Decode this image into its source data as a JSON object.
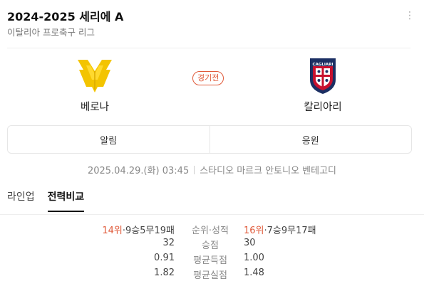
{
  "header": {
    "title": "2024-2025 세리에 A",
    "subtitle": "이탈리아 프로축구 리그"
  },
  "match": {
    "home": {
      "name": "베로나",
      "logo_icon": "verona-crest-icon"
    },
    "away": {
      "name": "칼리아리",
      "logo_icon": "cagliari-crest-icon",
      "logo_text": "CAGLIARI"
    },
    "status": "경기전",
    "datetime": "2025.04.29.(화) 03:45",
    "venue": "스타디오 마르크 안토니오 벤테고디"
  },
  "actions": {
    "alarm_label": "알림",
    "cheer_label": "응원"
  },
  "tabs": [
    {
      "label": "라인업"
    },
    {
      "label": "전력비교"
    }
  ],
  "stats": {
    "rows": [
      {
        "label": "순위·성적",
        "home_rank": "14위",
        "home_value": "·9승5무19패",
        "away_rank": "16위",
        "away_value": "·7승9무17패"
      },
      {
        "label": "승점",
        "home_value": "32",
        "away_value": "30"
      },
      {
        "label": "평균득점",
        "home_value": "0.91",
        "away_value": "1.00"
      },
      {
        "label": "평균실점",
        "home_value": "1.82",
        "away_value": "1.48"
      }
    ]
  },
  "colors": {
    "accent": "#e05a3a",
    "verona_yellow": "#f3c400",
    "cagliari_red": "#c8102e",
    "cagliari_blue": "#1b2f63"
  }
}
